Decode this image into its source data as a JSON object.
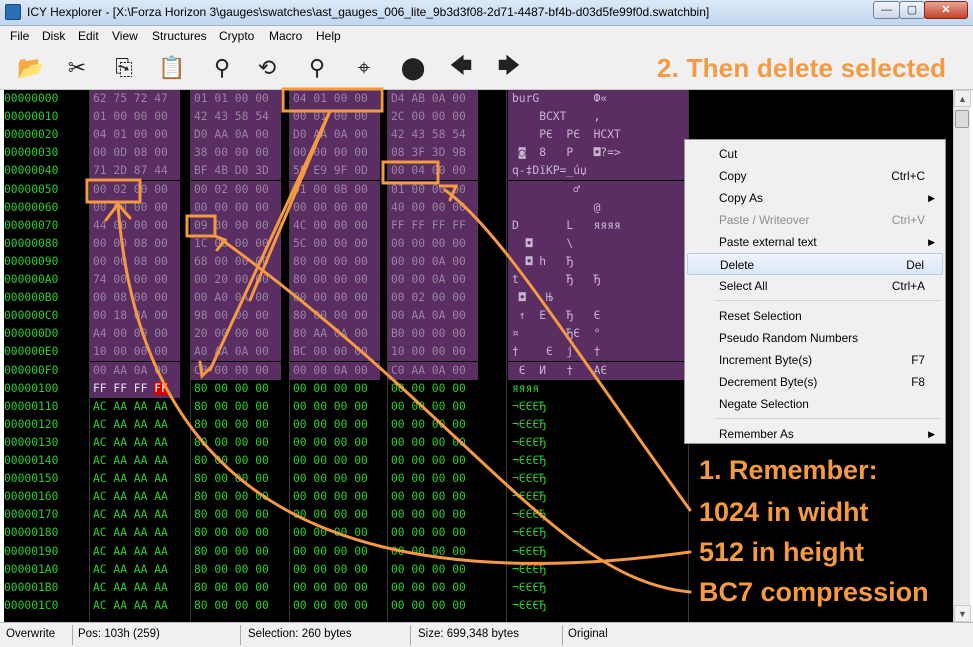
{
  "window": {
    "title": "ICY Hexplorer - [X:\\Forza Horizon 3\\gauges\\swatches\\ast_gauges_006_lite_9b3d3f08-2d71-4487-bf4b-d03d5fe99f0d.swatchbin]",
    "minimize": "—",
    "maximize": "▢",
    "close": "✕"
  },
  "menu": [
    "File",
    "Disk",
    "Edit",
    "View",
    "Structures",
    "Crypto",
    "Macro",
    "Help"
  ],
  "toolbar": [
    {
      "icon": "open-folder-icon",
      "glyph": "📂"
    },
    {
      "icon": "scissors-icon",
      "glyph": "✂"
    },
    {
      "icon": "copy-icon",
      "glyph": "⎘"
    },
    {
      "icon": "paste-icon",
      "glyph": "📋"
    },
    {
      "icon": "search-icon",
      "glyph": "⚲"
    },
    {
      "icon": "replace-icon",
      "glyph": "⟲"
    },
    {
      "icon": "find-next-icon",
      "glyph": "⚲"
    },
    {
      "icon": "goto-icon",
      "glyph": "⌖"
    },
    {
      "icon": "record-icon",
      "glyph": "⬤"
    },
    {
      "icon": "back-arrow-icon",
      "glyph": "🡄"
    },
    {
      "icon": "forward-arrow-icon",
      "glyph": "🡆"
    }
  ],
  "hint_top": "2. Then delete selected",
  "hex": {
    "rows": [
      {
        "off": "00000000",
        "g": [
          "62 75 72 47",
          "01 01 00 00",
          "04 01 00 00",
          "D4 AB 0A 00"
        ],
        "a": "burG        Ф«"
      },
      {
        "off": "00000010",
        "g": [
          "01 00 00 00",
          "42 43 58 54",
          "00 01 00 00",
          "2C 00 00 00"
        ],
        "a": "    BCXT    ,"
      },
      {
        "off": "00000020",
        "g": [
          "04 01 00 00",
          "D0 AA 0A 00",
          "D0 AA 0A 00",
          "42 43 58 54"
        ],
        "a": "    РЄ  РЄ  HCXT"
      },
      {
        "off": "00000030",
        "g": [
          "00 0D 08 00",
          "38 00 00 00",
          "00 00 00 00",
          "08 3F 3D 9B"
        ],
        "a": " ◙  8   P   ◘?=>"
      },
      {
        "off": "00000040",
        "g": [
          "71 2D 87 44",
          "BF 4B D0 3D",
          "5E E9 9F 0D",
          "00 04 00 00"
        ],
        "a": "q-‡DїKP=_úџ"
      },
      {
        "off": "00000050",
        "g": [
          "00 02 00 00",
          "00 02 00 00",
          "01 00 0B 00",
          "01 00 00 00"
        ],
        "a": "         ♂"
      },
      {
        "off": "00000060",
        "g": [
          "00 00 00 00",
          "00 00 00 00",
          "00 00 00 00",
          "40 00 00 00"
        ],
        "a": "            @"
      },
      {
        "off": "00000070",
        "g": [
          "44 00 00 00",
          "09 00 00 00",
          "4C 00 00 00",
          "FF FF FF FF"
        ],
        "a": "D       L   яяяя"
      },
      {
        "off": "00000080",
        "g": [
          "00 00 08 00",
          "1C 00 00 00",
          "5C 00 00 00",
          "00 00 00 00"
        ],
        "a": "  ◘     \\"
      },
      {
        "off": "00000090",
        "g": [
          "00 00 08 00",
          "68 00 00 00",
          "80 00 00 00",
          "00 00 0A 00"
        ],
        "a": "  ◘ h   Ђ"
      },
      {
        "off": "000000A0",
        "g": [
          "74 00 00 00",
          "00 20 00 00",
          "80 00 00 00",
          "00 00 0A 00"
        ],
        "a": "t       Ђ   Ђ"
      },
      {
        "off": "000000B0",
        "g": [
          "00 08 00 00",
          "00 A0 0A 00",
          "00 00 00 00",
          "00 02 00 00"
        ],
        "a": " ◘   Њ"
      },
      {
        "off": "000000C0",
        "g": [
          "00 18 0A 00",
          "98 00 00 00",
          "80 00 00 00",
          "00 AA 0A 00"
        ],
        "a": " ↑  E   Ђ   Є"
      },
      {
        "off": "000000D0",
        "g": [
          "A4 00 00 00",
          "20 00 00 00",
          "80 AA 0A 00",
          "B0 00 00 00"
        ],
        "a": "¤       ЂЄ  °"
      },
      {
        "off": "000000E0",
        "g": [
          "10 00 00 00",
          "A0 AA 0A 00",
          "BC 00 00 00",
          "10 00 00 00"
        ],
        "a": "†    Є  ј   †"
      },
      {
        "off": "000000F0",
        "g": [
          "00 AA 0A 00",
          "C8 00 00 00",
          "00 00 0A 00",
          "C0 AA 0A 00"
        ],
        "a": " Є  И   †   АЄ"
      },
      {
        "off": "00000100",
        "g": [
          "FF FF FF FF",
          "80 00 00 00",
          "00 00 00 00",
          "00 00 00 00"
        ],
        "a": "яяяя"
      },
      {
        "off": "00000110",
        "g": [
          "AC AA AA AA",
          "80 00 00 00",
          "00 00 00 00",
          "00 00 00 00"
        ],
        "a": "¬ЄЄЄЂ"
      },
      {
        "off": "00000120",
        "g": [
          "AC AA AA AA",
          "80 00 00 00",
          "00 00 00 00",
          "00 00 00 00"
        ],
        "a": "¬ЄЄЄЂ"
      },
      {
        "off": "00000130",
        "g": [
          "AC AA AA AA",
          "80 00 00 00",
          "00 00 00 00",
          "00 00 00 00"
        ],
        "a": "¬ЄЄЄЂ"
      },
      {
        "off": "00000140",
        "g": [
          "AC AA AA AA",
          "80 00 00 00",
          "00 00 00 00",
          "00 00 00 00"
        ],
        "a": "¬ЄЄЄЂ"
      },
      {
        "off": "00000150",
        "g": [
          "AC AA AA AA",
          "80 00 00 00",
          "00 00 00 00",
          "00 00 00 00"
        ],
        "a": "¬ЄЄЄЂ"
      },
      {
        "off": "00000160",
        "g": [
          "AC AA AA AA",
          "80 00 00 00",
          "00 00 00 00",
          "00 00 00 00"
        ],
        "a": "¬ЄЄЄЂ"
      },
      {
        "off": "00000170",
        "g": [
          "AC AA AA AA",
          "80 00 00 00",
          "00 00 00 00",
          "00 00 00 00"
        ],
        "a": "¬ЄЄЄЂ"
      },
      {
        "off": "00000180",
        "g": [
          "AC AA AA AA",
          "80 00 00 00",
          "00 00 00 00",
          "00 00 00 00"
        ],
        "a": "¬ЄЄЄЂ"
      },
      {
        "off": "00000190",
        "g": [
          "AC AA AA AA",
          "80 00 00 00",
          "00 00 00 00",
          "00 00 00 00"
        ],
        "a": "¬ЄЄЄЂ"
      },
      {
        "off": "000001A0",
        "g": [
          "AC AA AA AA",
          "80 00 00 00",
          "00 00 00 00",
          "00 00 00 00"
        ],
        "a": "¬ЄЄЄЂ"
      },
      {
        "off": "000001B0",
        "g": [
          "AC AA AA AA",
          "80 00 00 00",
          "00 00 00 00",
          "00 00 00 00"
        ],
        "a": "¬ЄЄЄЂ"
      },
      {
        "off": "000001C0",
        "g": [
          "AC AA AA AA",
          "80 00 00 00",
          "00 00 00 00",
          "00 00 00 00"
        ],
        "a": "¬ЄЄЄЂ"
      }
    ],
    "selected_rows": 16,
    "colors": {
      "selected_bg": "#5a2d63",
      "hex_green": "#2ecc2e",
      "cursor_red": "#d60000"
    }
  },
  "context_menu": [
    {
      "label": "Cut",
      "shortcut": "",
      "disabled": false
    },
    {
      "label": "Copy",
      "shortcut": "Ctrl+C",
      "disabled": false
    },
    {
      "label": "Copy As",
      "shortcut": "",
      "submenu": true,
      "disabled": false
    },
    {
      "label": "Paste / Writeover",
      "shortcut": "Ctrl+V",
      "disabled": true
    },
    {
      "label": "Paste external text",
      "shortcut": "",
      "submenu": true,
      "disabled": false
    },
    {
      "label": "Delete",
      "shortcut": "Del",
      "disabled": false,
      "highlighted": true
    },
    {
      "label": "Select All",
      "shortcut": "Ctrl+A",
      "disabled": false
    },
    {
      "label": "Reset Selection",
      "shortcut": "",
      "disabled": false,
      "sep_before": true
    },
    {
      "label": "Pseudo Random Numbers",
      "shortcut": "",
      "disabled": false
    },
    {
      "label": "Increment Byte(s)",
      "shortcut": "F7",
      "disabled": false
    },
    {
      "label": "Decrement Byte(s)",
      "shortcut": "F8",
      "disabled": false
    },
    {
      "label": "Negate Selection",
      "shortcut": "",
      "disabled": false
    },
    {
      "label": "Remember As",
      "shortcut": "",
      "submenu": true,
      "disabled": false,
      "sep_before": true
    }
  ],
  "annotations": {
    "remember": "1. Remember:",
    "width": "1024 in widht",
    "height": "512 in height",
    "compression": "BC7 compression",
    "color": "#f39a42"
  },
  "status": {
    "mode": "Overwrite",
    "pos": "Pos: 103h (259)",
    "selection": "Selection: 260 bytes",
    "size": "Size: 699,348 bytes",
    "state": "Original"
  }
}
